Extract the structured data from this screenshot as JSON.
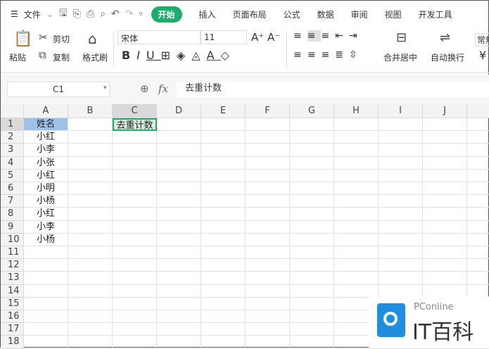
{
  "menu": {
    "file": "文件"
  },
  "tabs": [
    "开始",
    "插入",
    "页面布局",
    "公式",
    "数据",
    "审阅",
    "视图",
    "开发工具"
  ],
  "ribbon": {
    "paste": "粘贴",
    "cut": "剪切",
    "copy": "复制",
    "format_painter": "格式刷",
    "font": "宋体",
    "size": "11",
    "merge": "合并居中",
    "wrap": "自动换行",
    "normal": "常规"
  },
  "formula": {
    "cell_ref": "C1",
    "fx": "fx",
    "value": "去重计数"
  },
  "columns": [
    "A",
    "B",
    "C",
    "D",
    "E",
    "F",
    "G",
    "H",
    "I",
    "J"
  ],
  "rows": [
    "1",
    "2",
    "3",
    "4",
    "5",
    "6",
    "7",
    "8",
    "9",
    "10",
    "11",
    "12",
    "13",
    "14",
    "15",
    "16",
    "17",
    "18"
  ],
  "colA": [
    "姓名",
    "小红",
    "小李",
    "小张",
    "小红",
    "小明",
    "小杨",
    "小红",
    "小李",
    "小杨"
  ],
  "c1": "去重计数",
  "watermark": {
    "brand": "PConline",
    "name": "IT百科"
  }
}
